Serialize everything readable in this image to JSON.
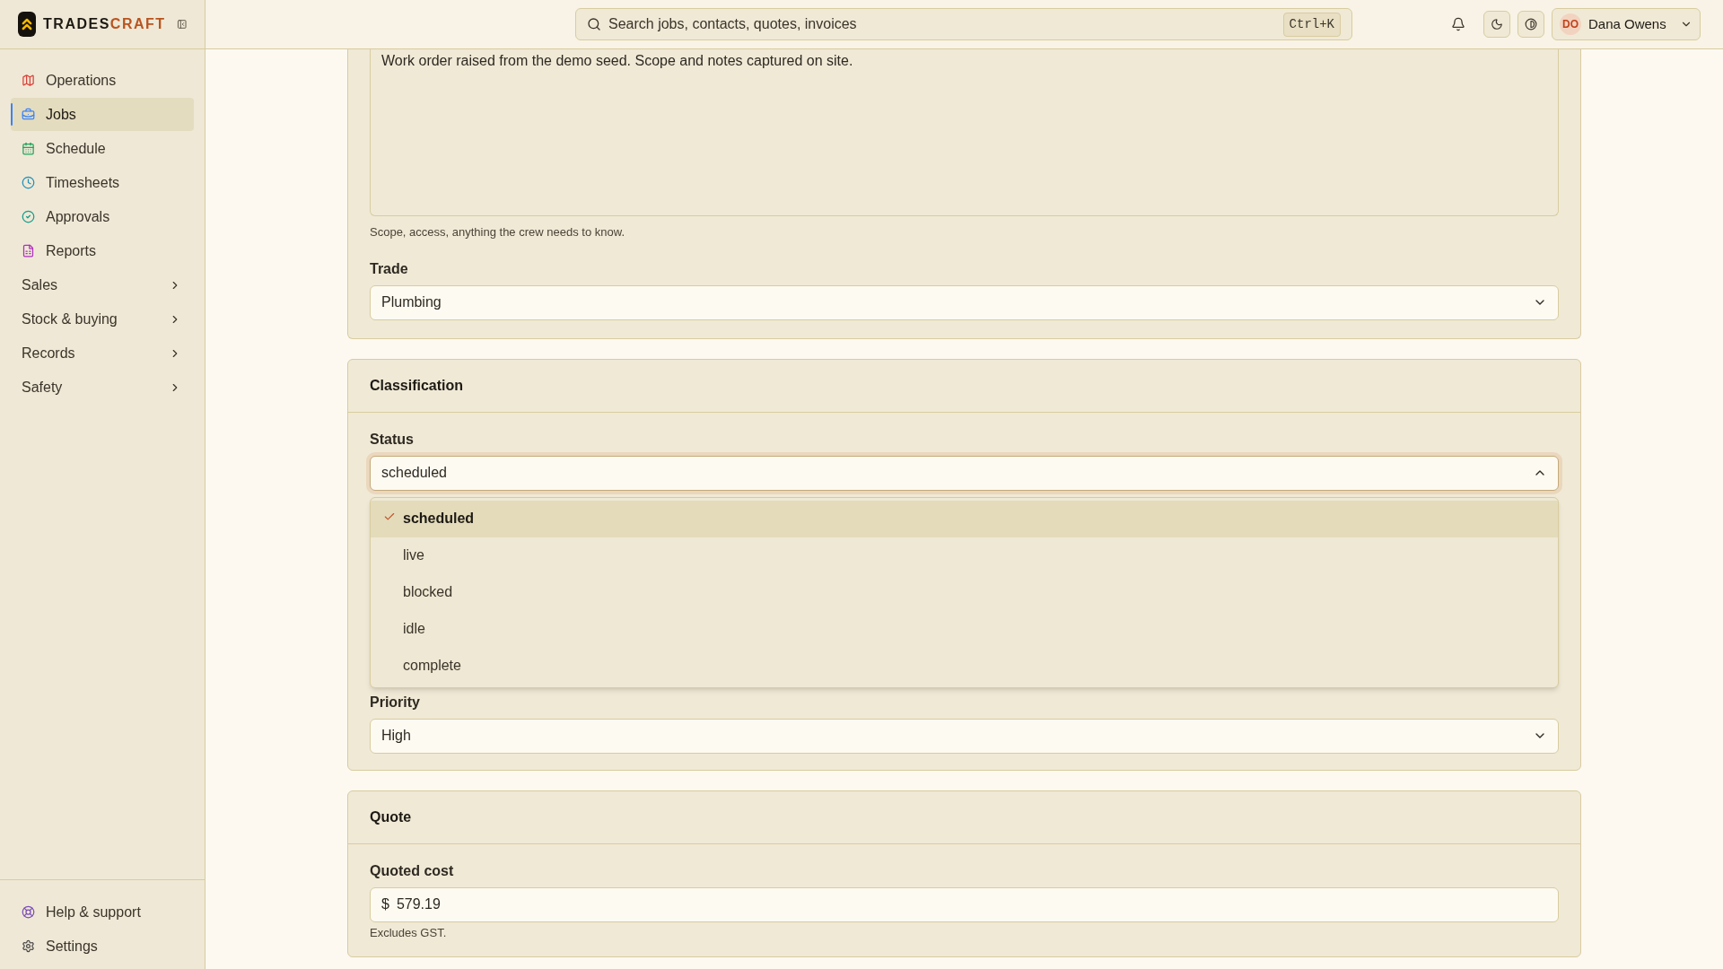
{
  "brand": {
    "name_first": "TRADES",
    "name_second": "CRAFT"
  },
  "sidebar": {
    "items": [
      {
        "label": "Operations",
        "kind": "link",
        "selected": false
      },
      {
        "label": "Jobs",
        "kind": "link",
        "selected": true
      },
      {
        "label": "Schedule",
        "kind": "link",
        "selected": false
      },
      {
        "label": "Timesheets",
        "kind": "link",
        "selected": false
      },
      {
        "label": "Approvals",
        "kind": "link",
        "selected": false
      },
      {
        "label": "Reports",
        "kind": "link",
        "selected": false
      },
      {
        "label": "Sales",
        "kind": "group",
        "selected": false
      },
      {
        "label": "Stock & buying",
        "kind": "group",
        "selected": false
      },
      {
        "label": "Records",
        "kind": "group",
        "selected": false
      },
      {
        "label": "Safety",
        "kind": "group",
        "selected": false
      }
    ],
    "footer_items": [
      {
        "label": "Help & support"
      },
      {
        "label": "Settings"
      }
    ]
  },
  "topbar": {
    "search": {
      "placeholder": "Search jobs, contacts, quotes, invoices",
      "shortcut": "Ctrl+K"
    },
    "user": {
      "initials": "DO",
      "name": "Dana Owens"
    }
  },
  "details_card": {
    "notes": {
      "value": "Work order raised from the demo seed. Scope and notes captured on site.",
      "hint": "Scope, access, anything the crew needs to know."
    },
    "trade": {
      "label": "Trade",
      "value": "Plumbing"
    }
  },
  "classification_card": {
    "title": "Classification",
    "status": {
      "label": "Status",
      "value": "scheduled",
      "expanded": true,
      "options": [
        {
          "label": "scheduled",
          "selected": true
        },
        {
          "label": "live",
          "selected": false
        },
        {
          "label": "blocked",
          "selected": false
        },
        {
          "label": "idle",
          "selected": false
        },
        {
          "label": "complete",
          "selected": false
        }
      ]
    },
    "priority": {
      "label": "Priority",
      "value": "High"
    }
  },
  "quote_card": {
    "title": "Quote",
    "quoted_cost": {
      "label": "Quoted cost",
      "prefix": "$",
      "value": "579.19",
      "hint": "Excludes GST."
    }
  }
}
